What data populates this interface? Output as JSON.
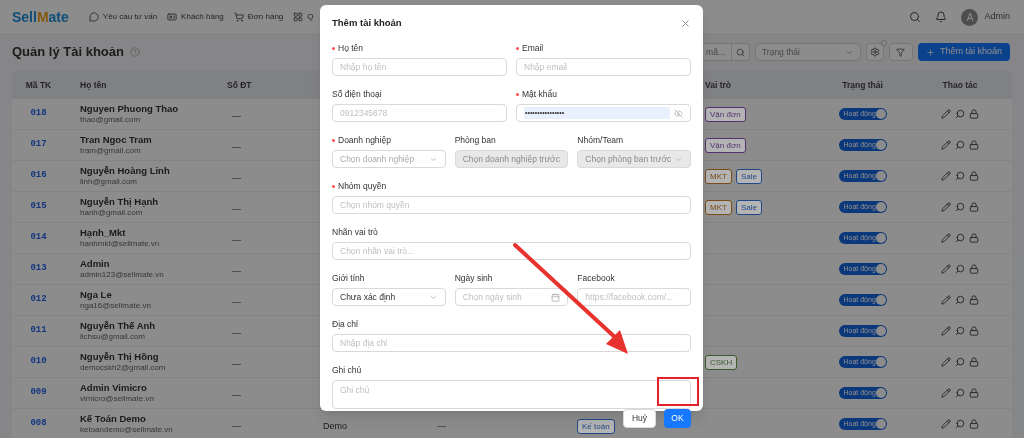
{
  "nav": {
    "logo": {
      "prefix": "Sell",
      "mark": "M",
      "suffix": "ate"
    },
    "items": [
      {
        "label": "Yêu cầu tư vấn"
      },
      {
        "label": "Khách hàng"
      },
      {
        "label": "Đơn hàng"
      },
      {
        "label": "Q"
      }
    ],
    "user": {
      "avatar": "A",
      "name": "Admin"
    }
  },
  "page": {
    "title": "Quản lý Tài khoản",
    "search_placeholder": "mã...",
    "status_placeholder": "Trạng thái",
    "add_button": "Thêm tài khoản"
  },
  "table": {
    "columns": [
      "Mã TK",
      "Họ tên",
      "Số ĐT",
      "",
      "",
      "",
      "Vai trò",
      "Trạng thái",
      "Thao tác"
    ],
    "rows": [
      {
        "code": "018",
        "name": "Nguyen Phuong Thao",
        "email": "thao@gmail.com",
        "phone": "—",
        "roles": [
          {
            "label": "Vận đơn",
            "color": "#553172"
          }
        ],
        "status": {
          "label": "Hoạt động",
          "on": true
        }
      },
      {
        "code": "017",
        "name": "Tran Ngoc Tram",
        "email": "tram@gmail.com",
        "phone": "—",
        "roles": [
          {
            "label": "Vận đơn",
            "color": "#553172"
          }
        ],
        "status": {
          "label": "Hoạt động",
          "on": true
        }
      },
      {
        "code": "016",
        "name": "Nguyễn Hoàng Linh",
        "email": "linh@gmail.com",
        "phone": "—",
        "roles": [
          {
            "label": "MKT",
            "color": "#7b4c18"
          },
          {
            "label": "Sale",
            "color": "#204887"
          }
        ],
        "status": {
          "label": "Hoạt động",
          "on": true
        }
      },
      {
        "code": "015",
        "name": "Nguyễn Thị Hạnh",
        "email": "hanh@gmail.com",
        "phone": "—",
        "roles": [
          {
            "label": "MKT",
            "color": "#7b4c18"
          },
          {
            "label": "Sale",
            "color": "#204887"
          }
        ],
        "status": {
          "label": "Hoạt động",
          "on": true
        }
      },
      {
        "code": "014",
        "name": "Hạnh_Mkt",
        "email": "hanhmkt@sellmate.vn",
        "phone": "—",
        "roles": [],
        "status": {
          "label": "Hoạt động",
          "on": true
        }
      },
      {
        "code": "013",
        "name": "Admin",
        "email": "admin123@sellmate.vn",
        "phone": "—",
        "roles": [],
        "status": {
          "label": "Hoạt động",
          "on": true
        }
      },
      {
        "code": "012",
        "name": "Nga Le",
        "email": "nga16@sellmate.vn",
        "phone": "—",
        "roles": [],
        "status": {
          "label": "Hoạt động",
          "on": true
        }
      },
      {
        "code": "011",
        "name": "Nguyễn Thế Anh",
        "email": "lichsu@gmail.com",
        "phone": "—",
        "roles": [],
        "status": {
          "label": "Hoạt động",
          "on": true
        }
      },
      {
        "code": "010",
        "name": "Nguyễn Thị Hồng",
        "email": "democskh2@gmail.com",
        "phone": "—",
        "roles": [
          {
            "label": "CSKH",
            "color": "#3a5c2b"
          }
        ],
        "status": {
          "label": "Hoạt động",
          "on": true
        }
      },
      {
        "code": "009",
        "name": "Admin Vimicro",
        "email": "vimicro@sellmate.vn",
        "phone": "—",
        "roles": [],
        "status": {
          "label": "Hoạt động",
          "on": true
        }
      },
      {
        "code": "008",
        "name": "Kế Toán Demo",
        "email": "ketoandemo@sellmate.vn",
        "phone": "—",
        "column_4": "Demo",
        "column_5": "—",
        "column_6": {
          "label": "Kế toán",
          "color": "#204887"
        },
        "roles": [],
        "status": {
          "label": "Hoạt động",
          "on": true
        }
      }
    ]
  },
  "dialog": {
    "title": "Thêm tài khoản",
    "rows": [
      [
        {
          "kind": "text",
          "label": "Họ tên",
          "required": true,
          "placeholder": "Nhập họ tên"
        },
        {
          "kind": "text",
          "label": "Email",
          "required": true,
          "placeholder": "Nhập email"
        }
      ],
      [
        {
          "kind": "text",
          "label": "Số điện thoại",
          "required": false,
          "placeholder": "0912345678"
        },
        {
          "kind": "password",
          "label": "Mật khẩu",
          "required": true,
          "value": "••••••••••••••••"
        }
      ],
      [
        {
          "kind": "select",
          "label": "Doanh nghiệp",
          "required": true,
          "placeholder": "Chọn doanh nghiệp",
          "disabled": false
        },
        {
          "kind": "select",
          "label": "Phòng ban",
          "required": false,
          "placeholder": "Chọn doanh nghiệp trước",
          "disabled": true
        },
        {
          "kind": "select",
          "label": "Nhóm/Team",
          "required": false,
          "placeholder": "Chọn phòng ban trước",
          "disabled": true
        }
      ],
      [
        {
          "kind": "text",
          "label": "Nhóm quyền",
          "required": true,
          "placeholder": "Chọn nhóm quyền"
        }
      ],
      [
        {
          "kind": "text",
          "label": "Nhãn vai trò",
          "required": false,
          "placeholder": "Chọn nhãn vai trò..."
        }
      ],
      [
        {
          "kind": "select",
          "label": "Giới tính",
          "required": false,
          "value": "Chưa xác định",
          "disabled": false
        },
        {
          "kind": "date",
          "label": "Ngày sinh",
          "required": false,
          "placeholder": "Chọn ngày sinh"
        },
        {
          "kind": "text",
          "label": "Facebook",
          "required": false,
          "placeholder": "https://facebook.com/..."
        }
      ],
      [
        {
          "kind": "text",
          "label": "Địa chỉ",
          "required": false,
          "placeholder": "Nhập địa chỉ"
        }
      ],
      [
        {
          "kind": "textarea",
          "label": "Ghi chú",
          "required": false,
          "placeholder": "Ghi chú"
        }
      ]
    ],
    "cancel": "Huỷ",
    "ok": "OK"
  }
}
